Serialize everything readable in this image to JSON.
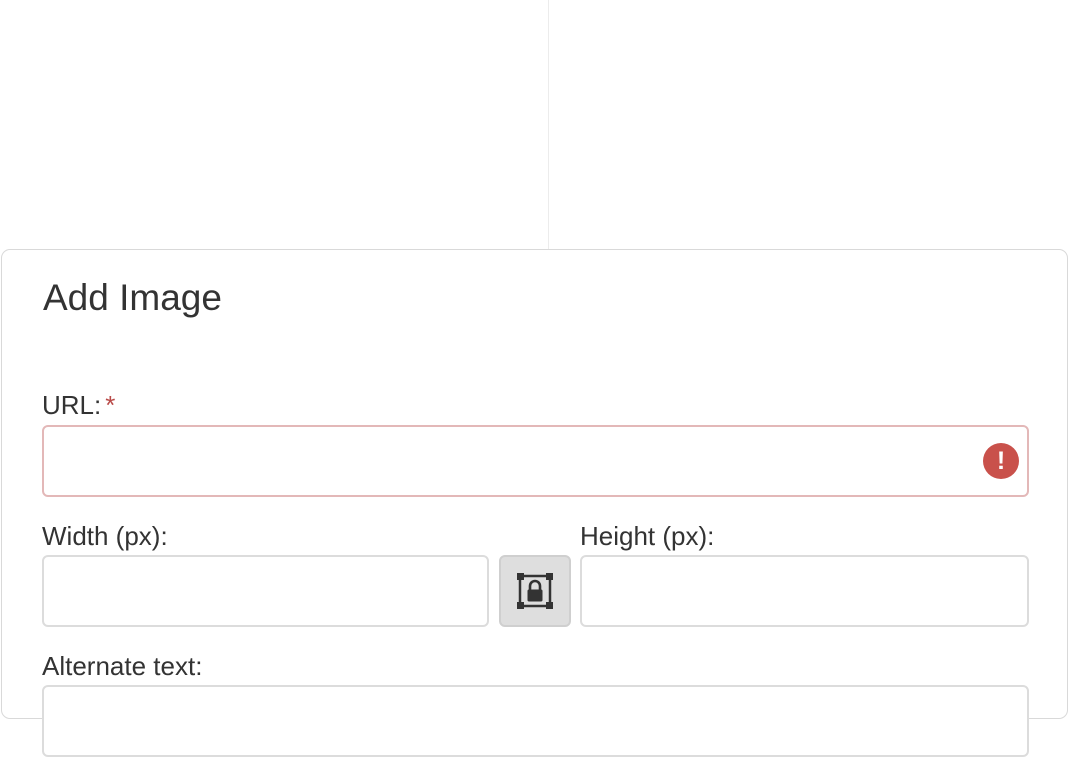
{
  "dialog": {
    "title": "Add Image",
    "url": {
      "label": "URL:",
      "required_mark": "*",
      "value": "",
      "error_icon": "exclamation-circle-icon",
      "error_color": "#c9514b"
    },
    "width": {
      "label": "Width (px):",
      "value": ""
    },
    "lock_button": {
      "icon": "lock-aspect-ratio-icon",
      "pressed": true
    },
    "height": {
      "label": "Height (px):",
      "value": ""
    },
    "alt_text": {
      "label": "Alternate text:",
      "value": ""
    }
  }
}
